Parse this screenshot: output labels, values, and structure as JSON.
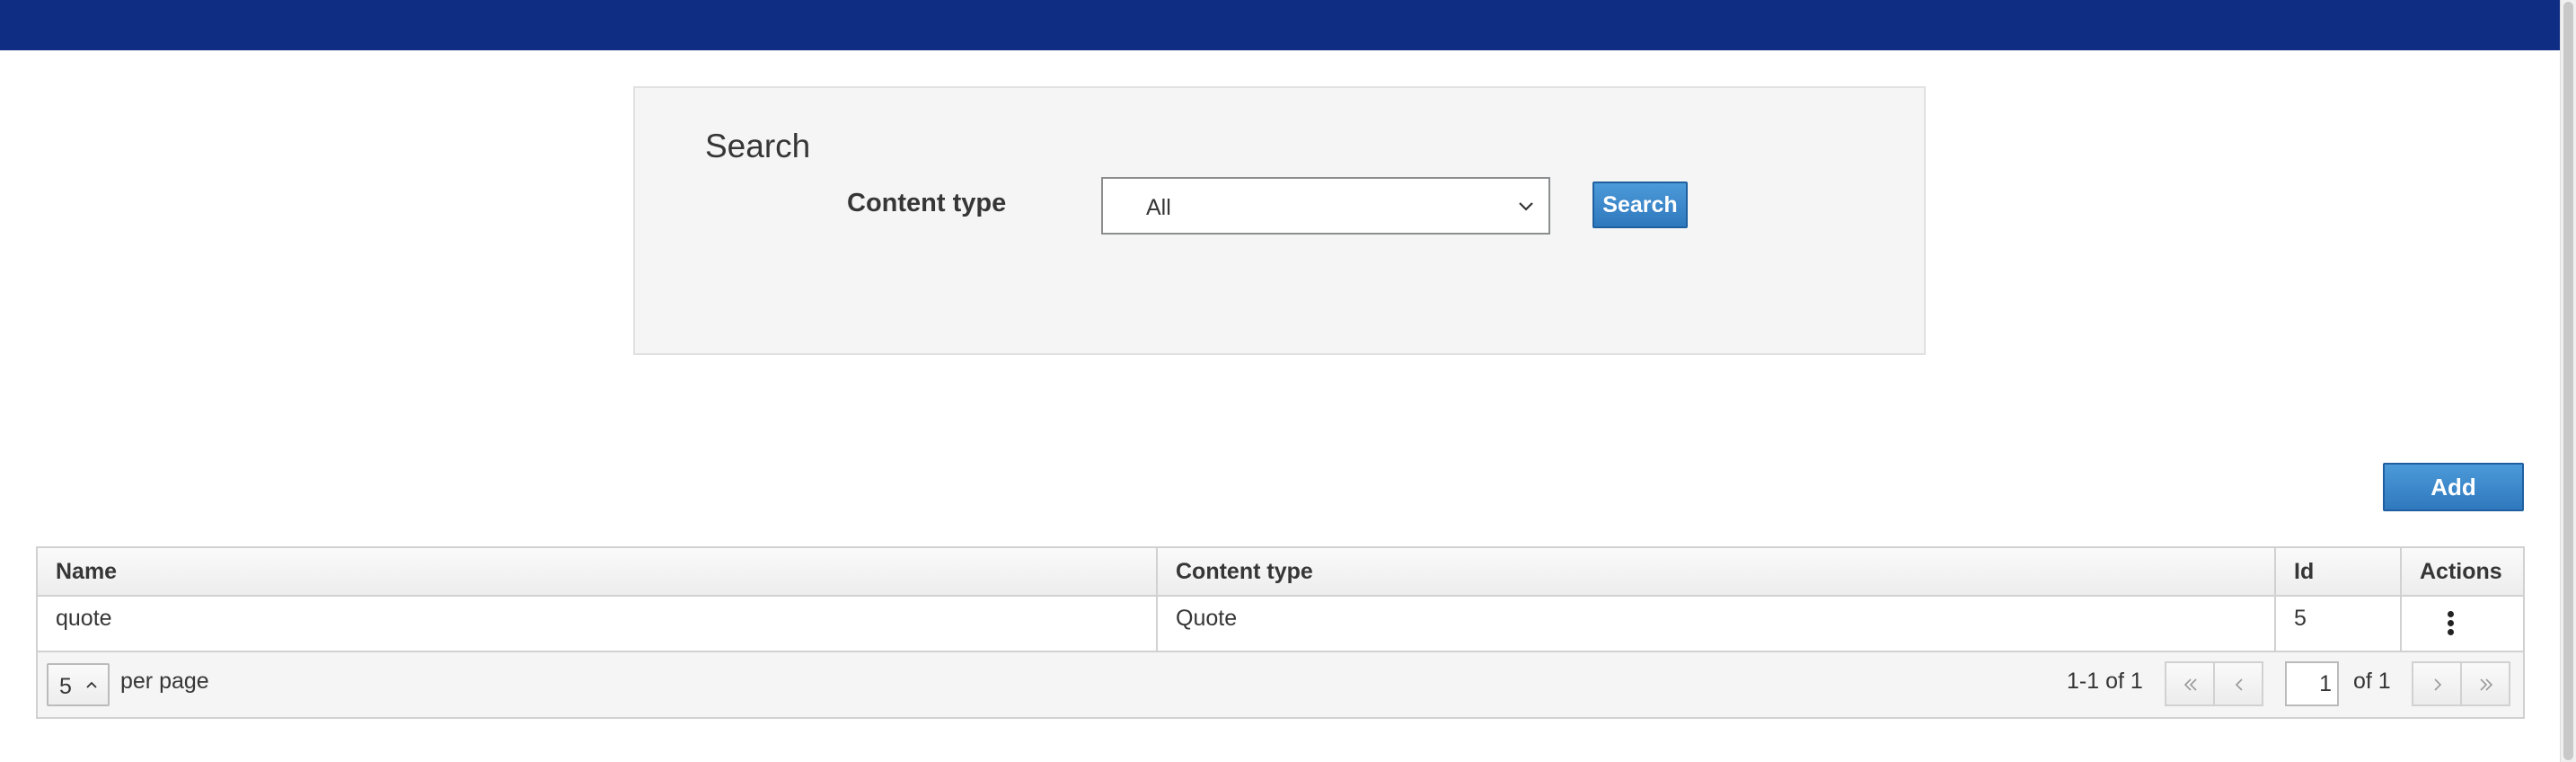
{
  "search": {
    "title": "Search",
    "content_type_label": "Content type",
    "content_type_value": "All",
    "search_button": "Search"
  },
  "actions": {
    "add_button": "Add"
  },
  "table": {
    "columns": [
      "Name",
      "Content type",
      "Id",
      "Actions"
    ],
    "rows": [
      {
        "name": "quote",
        "content_type": "Quote",
        "id": "5"
      }
    ]
  },
  "pagination": {
    "per_page_value": "5",
    "per_page_label": "per page",
    "range_text": "1-1 of 1",
    "current_page": "1",
    "of_pages": "of 1"
  },
  "colors": {
    "topbar": "#102d84",
    "primary_button": "#2f78bd"
  }
}
